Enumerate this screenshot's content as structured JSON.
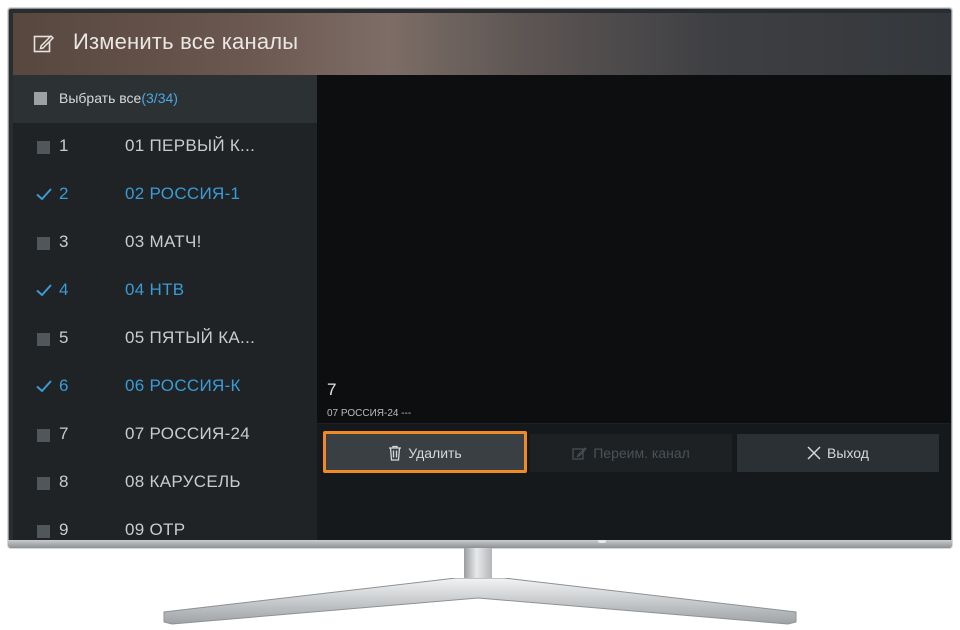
{
  "header": {
    "title": "Изменить все каналы",
    "icon": "edit-icon"
  },
  "select_all": {
    "label": "Выбрать все",
    "count": "(3/34)",
    "checked": false
  },
  "channels": [
    {
      "number": "1",
      "name": "01 ПЕРВЫЙ К...",
      "checked": false
    },
    {
      "number": "2",
      "name": "02 РОССИЯ-1",
      "checked": true
    },
    {
      "number": "3",
      "name": "03 МАТЧ!",
      "checked": false
    },
    {
      "number": "4",
      "name": "04 НТВ",
      "checked": true
    },
    {
      "number": "5",
      "name": "05 ПЯТЫЙ КА...",
      "checked": false
    },
    {
      "number": "6",
      "name": "06 РОССИЯ-К",
      "checked": true
    },
    {
      "number": "7",
      "name": "07 РОССИЯ-24",
      "checked": false
    },
    {
      "number": "8",
      "name": "08 КАРУСЕЛЬ",
      "checked": false
    },
    {
      "number": "9",
      "name": "09 ОТР",
      "checked": false
    }
  ],
  "info": {
    "number": "7",
    "subtitle": "07 РОССИЯ-24 ---"
  },
  "buttons": {
    "delete": "Удалить",
    "rename": "Переим. канал",
    "exit": "Выход"
  },
  "colors": {
    "accent": "#3a9bd6",
    "focus": "#f08a24"
  }
}
